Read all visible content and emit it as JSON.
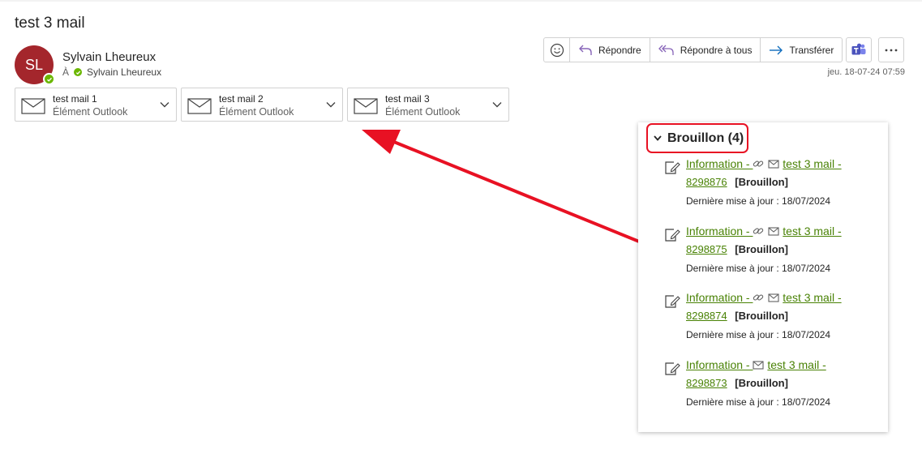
{
  "email": {
    "subject": "test 3 mail",
    "sender": {
      "initials": "SL",
      "name": "Sylvain Lheureux",
      "avatar_color": "#a4262c"
    },
    "to_label": "À",
    "recipient": "Sylvain Lheureux",
    "date": "jeu. 18-07-24 07:59"
  },
  "attachments": [
    {
      "name": "test mail 1",
      "type": "Élément Outlook",
      "icon": "envelope-icon"
    },
    {
      "name": "test mail 2",
      "type": "Élément Outlook",
      "icon": "envelope-icon"
    },
    {
      "name": "test mail 3",
      "type": "Élément Outlook",
      "icon": "envelope-icon"
    }
  ],
  "toolbar": {
    "emoji_icon": "emoji-icon",
    "reply_label": "Répondre",
    "reply_all_label": "Répondre à tous",
    "forward_label": "Transférer",
    "teams_icon": "teams-icon",
    "more_icon": "more-icon"
  },
  "drafts_panel": {
    "title": "Brouillon (4)",
    "highlight_color": "#e81123",
    "items": [
      {
        "title_prefix": "Information - ",
        "subject": "test 3 mail -",
        "number": "8298876",
        "tag": "[Brouillon]",
        "updated": "Dernière mise à jour : 18/07/2024",
        "has_link_icon": true
      },
      {
        "title_prefix": "Information - ",
        "subject": "test 3 mail -",
        "number": "8298875",
        "tag": "[Brouillon]",
        "updated": "Dernière mise à jour : 18/07/2024",
        "has_link_icon": true
      },
      {
        "title_prefix": "Information - ",
        "subject": "test 3 mail -",
        "number": "8298874",
        "tag": "[Brouillon]",
        "updated": "Dernière mise à jour : 18/07/2024",
        "has_link_icon": true
      },
      {
        "title_prefix": "Information - ",
        "subject": "test 3 mail -",
        "number": "8298873",
        "tag": "[Brouillon]",
        "updated": "Dernière mise à jour : 18/07/2024",
        "has_link_icon": false
      }
    ]
  },
  "annotation": {
    "arrow_color": "#e81123"
  }
}
